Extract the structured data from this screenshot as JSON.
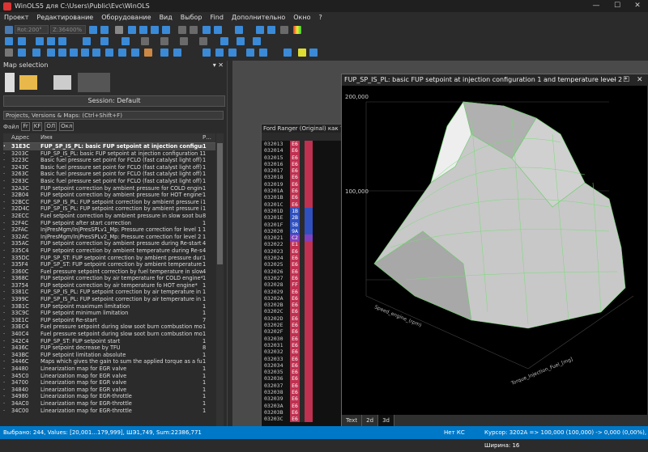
{
  "window": {
    "title": "WinOLS5 для C:\\Users\\Public\\Evc\\WinOLS"
  },
  "menu": [
    "Проект",
    "Редактирование",
    "Оборудование",
    "Вид",
    "Выбор",
    "Find",
    "Дополнительно",
    "Окно",
    "?"
  ],
  "toolbar": {
    "rot": "Rot:200°",
    "zoom": "Z:36400%"
  },
  "map_selection": {
    "title": "Map selection",
    "session": "Session: Default",
    "projects": "Projects, Versions & Maps: (Ctrl+Shift+F)",
    "filter": {
      "file": "Файл",
      "f": "Fr",
      "k": "KF",
      "ol": "ОЛ",
      "oki": "Окл"
    },
    "columns": {
      "addr": "Адрес",
      "name": "Имя",
      "r": "Р..."
    },
    "rows": [
      {
        "addr": "31E3C",
        "name": "FUP_SP_IS_PL: basic FUP setpoint at injection configurat",
        "r": "1",
        "sel": true
      },
      {
        "addr": "3203C",
        "name": "FUP_SP_IS_PL: basic FUP setpoint at injection configuration 1 ar",
        "r": "1"
      },
      {
        "addr": "3223C",
        "name": "Basic fuel pressure set point for FCLO (fast catalyst light off) con",
        "r": "1"
      },
      {
        "addr": "3243C",
        "name": "Basic fuel pressure set point for FCLO (fast catalyst light off) con",
        "r": "1"
      },
      {
        "addr": "3263C",
        "name": "Basic fuel pressure set point for FCLO (fast catalyst light off) con",
        "r": "1"
      },
      {
        "addr": "3283C",
        "name": "Basic fuel pressure set point for FCLO (fast catalyst light off) con",
        "r": "1"
      },
      {
        "addr": "32A3C",
        "name": "FUP setpoint correction by ambient pressure for COLD engine*",
        "r": "1"
      },
      {
        "addr": "32B04",
        "name": "FUP setpoint correction by ambient pressure for HOT engine*",
        "r": "1"
      },
      {
        "addr": "32BCC",
        "name": "FUP_SP_IS_PL: FUP setpoint correction by ambient pressure in",
        "r": "1"
      },
      {
        "addr": "32D4C",
        "name": "FUP_SP_IS_PL: FUP setpoint correction by ambient pressure in",
        "r": "1"
      },
      {
        "addr": "32ECC",
        "name": "Fuel setpoint correction by ambient pressure in slow soot burn c",
        "r": "8"
      },
      {
        "addr": "32F4C",
        "name": "FUP setpoint after start correction",
        "r": "1"
      },
      {
        "addr": "32FAC",
        "name": "InjPresMgm/InjPresSPLv1_Mp: Pressure correction for level 1 *",
        "r": "1"
      },
      {
        "addr": "332AC",
        "name": "InjPresMgm/InjPresSPLv2_Mp: Pressure correction for level 2 *",
        "r": "1"
      },
      {
        "addr": "335AC",
        "name": "FUP setpoint correction by ambient pressure during Re-start",
        "r": "4"
      },
      {
        "addr": "335C4",
        "name": "FUP setpoint correction by ambient temperature during Re-start",
        "r": "4"
      },
      {
        "addr": "335DC",
        "name": "FUP_SP_ST: FUP setpoint correction by ambient pressure during",
        "r": "1"
      },
      {
        "addr": "335F4",
        "name": "FUP_SP_ST: FUP setpoint correction by ambient temperature d",
        "r": "1"
      },
      {
        "addr": "3360C",
        "name": "Fuel pressure setpoint correction by fuel temperature in slow soo",
        "r": "4"
      },
      {
        "addr": "3368C",
        "name": "FUP setpoint correction by air temperature for COLD engine*",
        "r": "1"
      },
      {
        "addr": "33754",
        "name": "FUP setpoint correction by air temperature fo HOT engine*",
        "r": "1"
      },
      {
        "addr": "3381C",
        "name": "FUP_SP_IS_PL: FUP setpoint correction by air temperature in",
        "r": "1"
      },
      {
        "addr": "3399C",
        "name": "FUP_SP_IS_PL: FUP setpoint correction by air temperature in hc",
        "r": "1"
      },
      {
        "addr": "33B1C",
        "name": "FUP setpoint maximum limitation",
        "r": "1"
      },
      {
        "addr": "33C9C",
        "name": "FUP setpoint minimum limitation",
        "r": "1"
      },
      {
        "addr": "33E1C",
        "name": "FUP setpoint Re-start",
        "r": "7"
      },
      {
        "addr": "33EC4",
        "name": "Fuel pressure setpoint during slow soot burn combustion mode",
        "r": "1"
      },
      {
        "addr": "340C4",
        "name": "Fuel pressure setpoint during slow soot burn combustion mode",
        "r": "1"
      },
      {
        "addr": "342C4",
        "name": "FUP_SP_ST: FUP setpoint start",
        "r": "1"
      },
      {
        "addr": "3436C",
        "name": "FUP setpoint decrease by TFU",
        "r": "8"
      },
      {
        "addr": "343BC",
        "name": "FUP setpoint limitation absolute",
        "r": "1"
      },
      {
        "addr": "3446C",
        "name": "Maps which gives the gain to sum the applied torque as a functi",
        "r": "1"
      },
      {
        "addr": "34480",
        "name": "Linearization map for EGR valve",
        "r": "1"
      },
      {
        "addr": "345C0",
        "name": "Linearization map for EGR valve",
        "r": "1"
      },
      {
        "addr": "34700",
        "name": "Linearization map for EGR valve",
        "r": "1"
      },
      {
        "addr": "34840",
        "name": "Linearization map for EGR valve",
        "r": "1"
      },
      {
        "addr": "34980",
        "name": "Linearization map for EGR-throttle",
        "r": "1"
      },
      {
        "addr": "34AC0",
        "name": "Linearization map for EGR-throttle",
        "r": "1"
      },
      {
        "addr": "34C00",
        "name": "Linearization map for EGR-throttle",
        "r": "1"
      }
    ]
  },
  "hex": {
    "title": "Ford Ranger (Original) как ?, (",
    "rows": [
      {
        "a": "032013",
        "v": "E6",
        "c": "#c03050"
      },
      {
        "a": "032014",
        "v": "E6",
        "c": "#c03050"
      },
      {
        "a": "032015",
        "v": "E6",
        "c": "#c03050"
      },
      {
        "a": "032016",
        "v": "E6",
        "c": "#c03050"
      },
      {
        "a": "032017",
        "v": "E6",
        "c": "#c03050"
      },
      {
        "a": "032018",
        "v": "E6",
        "c": "#c03050"
      },
      {
        "a": "032019",
        "v": "E6",
        "c": "#c03050"
      },
      {
        "a": "03201A",
        "v": "E6",
        "c": "#c03050"
      },
      {
        "a": "03201B",
        "v": "E6",
        "c": "#c03050"
      },
      {
        "a": "03201C",
        "v": "E6",
        "c": "#c03050"
      },
      {
        "a": "03201D",
        "v": "1B",
        "c": "#3050c0"
      },
      {
        "a": "03201E",
        "v": "2B",
        "c": "#3050c0"
      },
      {
        "a": "03201F",
        "v": "5B",
        "c": "#3050c0"
      },
      {
        "a": "032020",
        "v": "9A",
        "c": "#3050c0"
      },
      {
        "a": "032021",
        "v": "C2",
        "c": "#8040c0"
      },
      {
        "a": "032022",
        "v": "E1",
        "c": "#c03050"
      },
      {
        "a": "032023",
        "v": "E6",
        "c": "#c03050"
      },
      {
        "a": "032024",
        "v": "E6",
        "c": "#c03050"
      },
      {
        "a": "032025",
        "v": "E6",
        "c": "#c03050"
      },
      {
        "a": "032026",
        "v": "E6",
        "c": "#c03050"
      },
      {
        "a": "032027",
        "v": "E6",
        "c": "#c03050"
      },
      {
        "a": "032028",
        "v": "FF",
        "c": "#c03050"
      },
      {
        "a": "032029",
        "v": "E6",
        "c": "#c03050"
      },
      {
        "a": "03202A",
        "v": "E6",
        "c": "#c03050"
      },
      {
        "a": "03202B",
        "v": "E6",
        "c": "#c03050"
      },
      {
        "a": "03202C",
        "v": "E6",
        "c": "#c03050"
      },
      {
        "a": "03202D",
        "v": "E6",
        "c": "#c03050"
      },
      {
        "a": "03202E",
        "v": "E6",
        "c": "#c03050"
      },
      {
        "a": "03202F",
        "v": "E6",
        "c": "#c03050"
      },
      {
        "a": "032030",
        "v": "E6",
        "c": "#c03050"
      },
      {
        "a": "032031",
        "v": "E6",
        "c": "#c03050"
      },
      {
        "a": "032032",
        "v": "E6",
        "c": "#c03050"
      },
      {
        "a": "032033",
        "v": "E6",
        "c": "#c03050"
      },
      {
        "a": "032034",
        "v": "E6",
        "c": "#c03050"
      },
      {
        "a": "032035",
        "v": "E6",
        "c": "#c03050"
      },
      {
        "a": "032036",
        "v": "E6",
        "c": "#c03050"
      },
      {
        "a": "032037",
        "v": "E6",
        "c": "#c03050"
      },
      {
        "a": "032038",
        "v": "E6",
        "c": "#c03050"
      },
      {
        "a": "032039",
        "v": "E6",
        "c": "#c03050"
      },
      {
        "a": "03203A",
        "v": "E6",
        "c": "#c03050"
      },
      {
        "a": "03203B",
        "v": "E6",
        "c": "#c03050"
      },
      {
        "a": "03203C",
        "v": "E6",
        "c": "#c03050"
      }
    ]
  },
  "plot": {
    "title": "FUP_SP_IS_PL: basic FUP setpoint at injection configuration 1 and temperature level 2 *",
    "z_labels": [
      "200,000",
      "100,000"
    ],
    "axis_y_label": "Speed_engine_(rpm)",
    "axis_x_label": "Torque_Injection_Fuel_[mg]"
  },
  "view_tabs": [
    "Text",
    "2d",
    "3d"
  ],
  "status": {
    "left": "Выбрано: 244, Values: [20,001...179,999], ШЭ1,749, Sum:22386,771",
    "net": "Нет КС",
    "cursor": "Курсор: 3202A => 100,000 (100,000) -> 0,000 (0,00%), Ширина: 16"
  }
}
